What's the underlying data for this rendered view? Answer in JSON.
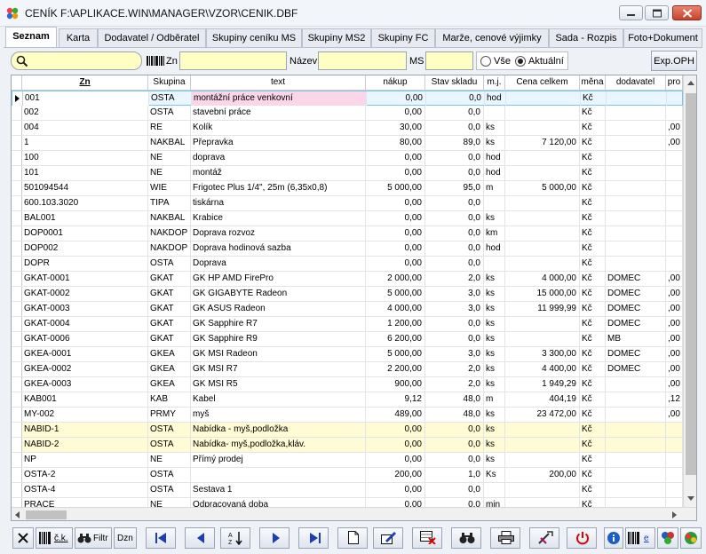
{
  "window": {
    "title": "CENÍK F:\\APLIKACE.WIN\\MANAGER\\VZOR\\CENIK.DBF"
  },
  "tabs": [
    {
      "label": "Seznam",
      "active": true
    },
    {
      "label": "Karta"
    },
    {
      "label": "Dodavatel / Odběratel"
    },
    {
      "label": "Skupiny ceníku MS"
    },
    {
      "label": "Skupiny MS2"
    },
    {
      "label": "Skupiny FC"
    },
    {
      "label": "Marže, cenové výjimky"
    },
    {
      "label": "Sada - Rozpis"
    },
    {
      "label": "Foto+Dokument"
    }
  ],
  "filter": {
    "search_value": "",
    "zn_label": "Zn",
    "zn_value": "",
    "nazev_label": "Název",
    "nazev_value": "",
    "ms_label": "MS",
    "ms_value": "",
    "radio_all": "Vše",
    "radio_current": "Aktuální",
    "radio_selected": "Aktuální",
    "export_label": "Exp.OPH"
  },
  "grid": {
    "columns": [
      "Zn",
      "Skupina",
      "text",
      "nákup",
      "Stav skladu",
      "m.j.",
      "Cena celkem",
      "měna",
      "dodavatel",
      "pro"
    ],
    "rows": [
      [
        "001",
        "OSTA",
        "montážní práce venkovní",
        "0,00",
        "0,0",
        "hod",
        "",
        "Kč",
        "",
        ""
      ],
      [
        "002",
        "OSTA",
        "stavební práce",
        "0,00",
        "0,0",
        "",
        "",
        "Kč",
        "",
        ""
      ],
      [
        "004",
        "RE",
        "Kolík",
        "30,00",
        "0,0",
        "ks",
        "",
        "Kč",
        "",
        ",00"
      ],
      [
        "1",
        "NAKBAL",
        "Přepravka",
        "80,00",
        "89,0",
        "ks",
        "7 120,00",
        "Kč",
        "",
        ",00"
      ],
      [
        "100",
        "NE",
        "doprava",
        "0,00",
        "0,0",
        "hod",
        "",
        "Kč",
        "",
        ""
      ],
      [
        "101",
        "NE",
        "montáž",
        "0,00",
        "0,0",
        "hod",
        "",
        "Kč",
        "",
        ""
      ],
      [
        "501094544",
        "WIE",
        "Frigotec Plus 1/4\", 25m (6,35x0,8)",
        "5 000,00",
        "95,0",
        "m",
        "5 000,00",
        "Kč",
        "",
        ""
      ],
      [
        "600.103.3020",
        "TIPA",
        "tiskárna",
        "0,00",
        "0,0",
        "",
        "",
        "Kč",
        "",
        ""
      ],
      [
        "BAL001",
        "NAKBAL",
        "Krabice",
        "0,00",
        "0,0",
        "ks",
        "",
        "Kč",
        "",
        ""
      ],
      [
        "DOP0001",
        "NAKDOP",
        "Doprava rozvoz",
        "0,00",
        "0,0",
        "km",
        "",
        "Kč",
        "",
        ""
      ],
      [
        "DOP002",
        "NAKDOP",
        "Doprava hodinová sazba",
        "0,00",
        "0,0",
        "hod",
        "",
        "Kč",
        "",
        ""
      ],
      [
        "DOPR",
        "OSTA",
        "Doprava",
        "0,00",
        "0,0",
        "",
        "",
        "Kč",
        "",
        ""
      ],
      [
        "GKAT-0001",
        "GKAT",
        "GK HP AMD FirePro",
        "2 000,00",
        "2,0",
        "ks",
        "4 000,00",
        "Kč",
        "DOMEC",
        ",00"
      ],
      [
        "GKAT-0002",
        "GKAT",
        "GK  GIGABYTE Radeon",
        "5 000,00",
        "3,0",
        "ks",
        "15 000,00",
        "Kč",
        "DOMEC",
        ",00"
      ],
      [
        "GKAT-0003",
        "GKAT",
        "GK ASUS Radeon",
        "4 000,00",
        "3,0",
        "ks",
        "11 999,99",
        "Kč",
        "DOMEC",
        ",00"
      ],
      [
        "GKAT-0004",
        "GKAT",
        "GK Sapphire R7",
        "1 200,00",
        "0,0",
        "ks",
        "",
        "Kč",
        "DOMEC",
        ",00"
      ],
      [
        "GKAT-0006",
        "GKAT",
        "GK Sapphire R9",
        "6 200,00",
        "0,0",
        "ks",
        "",
        "Kč",
        "MB",
        ",00"
      ],
      [
        "GKEA-0001",
        "GKEA",
        "GK MSI  Radeon",
        "5 000,00",
        "3,0",
        "ks",
        "3 300,00",
        "Kč",
        "DOMEC",
        ",00"
      ],
      [
        "GKEA-0002",
        "GKEA",
        "GK MSI R7",
        "2 200,00",
        "2,0",
        "ks",
        "4 400,00",
        "Kč",
        "DOMEC",
        ",00"
      ],
      [
        "GKEA-0003",
        "GKEA",
        "GK MSI R5",
        "900,00",
        "2,0",
        "ks",
        "1 949,29",
        "Kč",
        "",
        ",00"
      ],
      [
        "KAB001",
        "KAB",
        "Kabel",
        "9,12",
        "48,0",
        "m",
        "404,19",
        "Kč",
        "",
        ",12"
      ],
      [
        "MY-002",
        "PRMY",
        "myš",
        "489,00",
        "48,0",
        "ks",
        "23 472,00",
        "Kč",
        "",
        ",00"
      ],
      [
        "NABID-1",
        "OSTA",
        "Nabídka - myš,podložka",
        "0,00",
        "0,0",
        "ks",
        "",
        "Kč",
        "",
        ""
      ],
      [
        "NABID-2",
        "OSTA",
        "Nabídka- myš,podložka,kláv.",
        "0,00",
        "0,0",
        "ks",
        "",
        "Kč",
        "",
        ""
      ],
      [
        "NP",
        "NE",
        "Přímý prodej",
        "0,00",
        "0,0",
        "ks",
        "",
        "Kč",
        "",
        ""
      ],
      [
        "OSTA-2",
        "OSTA",
        "",
        "200,00",
        "1,0",
        "Ks",
        "200,00",
        "Kč",
        "",
        ""
      ],
      [
        "OSTA-4",
        "OSTA",
        "Sestava 1",
        "0,00",
        "0,0",
        "",
        "",
        "Kč",
        "",
        ""
      ],
      [
        "PRACE",
        "NE",
        "Odpracovaná doba",
        "0,00",
        "0,0",
        "min",
        "",
        "Kč",
        "",
        ""
      ]
    ]
  },
  "toolbar": {
    "ck_label": "č.k.",
    "filtr_label": "Filtr",
    "dzn_label": "Dzn",
    "e_label": "e"
  }
}
